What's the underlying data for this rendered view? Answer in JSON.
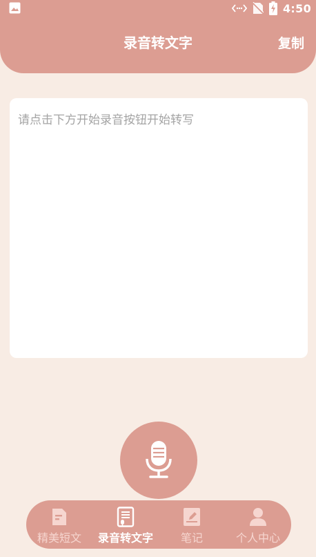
{
  "colors": {
    "accent": "#dc9d92",
    "background": "#f8ece4",
    "card": "#ffffff",
    "placeholder_text": "#a4a4a4",
    "nav_inactive": "#f6d6d0",
    "nav_active": "#ffffff"
  },
  "status_bar": {
    "left_icon": "image-icon",
    "icons": [
      "code-icon",
      "no-sim-icon",
      "battery-charging-icon"
    ],
    "time": "4:50"
  },
  "header": {
    "title": "录音转文字",
    "copy_label": "复制"
  },
  "transcript": {
    "placeholder": "请点击下方开始录音按钮开始转写"
  },
  "record_button": {
    "icon": "microphone-icon"
  },
  "bottom_nav": {
    "items": [
      {
        "label": "精美短文",
        "icon": "article-icon",
        "active": false
      },
      {
        "label": "录音转文字",
        "icon": "voice-document-icon",
        "active": true
      },
      {
        "label": "笔记",
        "icon": "notebook-icon",
        "active": false
      },
      {
        "label": "个人中心",
        "icon": "person-icon",
        "active": false
      }
    ]
  }
}
